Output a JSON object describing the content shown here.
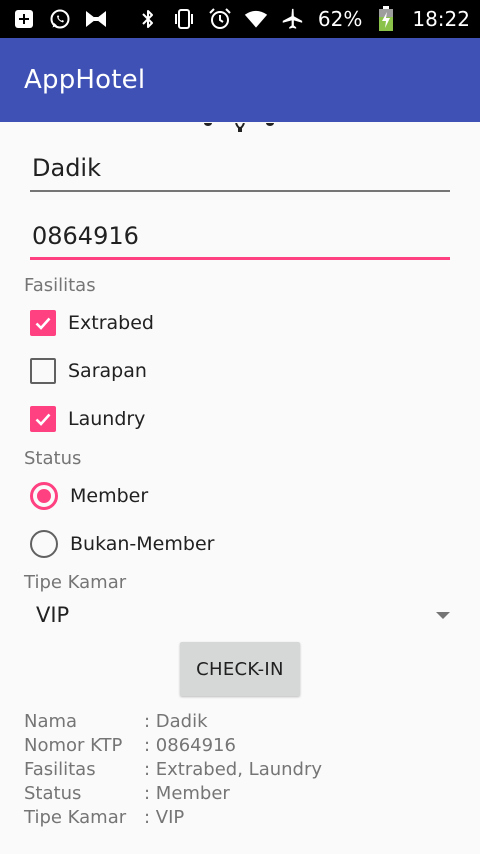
{
  "status_bar": {
    "battery_percent": "62%",
    "time": "18:22",
    "icons": [
      "plus-square-icon",
      "whatsapp-icon",
      "bowtie-icon",
      "bluetooth-icon",
      "vibrate-icon",
      "alarm-icon",
      "wifi-icon",
      "airplane-icon",
      "battery-charging-icon"
    ]
  },
  "app_bar": {
    "title": "AppHotel"
  },
  "form": {
    "nama_value": "Dadik",
    "ktp_value": "0864916",
    "fasilitas_label": "Fasilitas",
    "fasilitas_options": [
      {
        "label": "Extrabed",
        "checked": true
      },
      {
        "label": "Sarapan",
        "checked": false
      },
      {
        "label": "Laundry",
        "checked": true
      }
    ],
    "status_label": "Status",
    "status_options": [
      {
        "label": "Member",
        "selected": true
      },
      {
        "label": "Bukan-Member",
        "selected": false
      }
    ],
    "tipe_kamar_label": "Tipe Kamar",
    "tipe_kamar_value": "VIP",
    "checkin_label": "CHECK-IN"
  },
  "summary": [
    {
      "key": "Nama",
      "value": ": Dadik"
    },
    {
      "key": "Nomor KTP",
      "value": ": 0864916"
    },
    {
      "key": "Fasilitas",
      "value": ": Extrabed, Laundry"
    },
    {
      "key": "Status",
      "value": ": Member"
    },
    {
      "key": "Tipe Kamar",
      "value": ": VIP"
    }
  ],
  "colors": {
    "primary": "#3f51b5",
    "accent": "#ff4081",
    "status_bar": "#000000",
    "button_bg": "#d6d7d7"
  }
}
